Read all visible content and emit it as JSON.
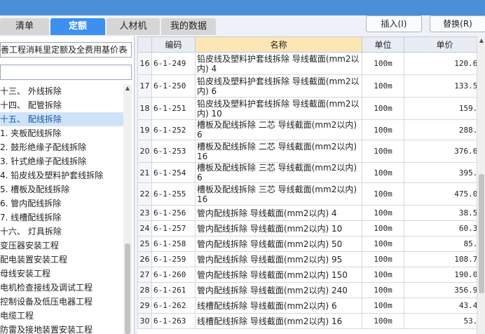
{
  "tabs": [
    {
      "label": "清单",
      "active": false
    },
    {
      "label": "定额",
      "active": true
    },
    {
      "label": "人材机",
      "active": false
    },
    {
      "label": "我的数据",
      "active": false
    }
  ],
  "toolbar": {
    "insert_label": "插入(I)",
    "replace_label": "替换(R)"
  },
  "left_panel": {
    "quota_library": "善工程消耗里定额及全费用基价表",
    "search_value": "",
    "tree_items": [
      {
        "label": "十三、 外线拆除",
        "selected": false
      },
      {
        "label": "十四、 配管拆除",
        "selected": false
      },
      {
        "label": "十五、 配线拆除",
        "selected": true
      },
      {
        "label": "1. 夹板配线拆除",
        "selected": false
      },
      {
        "label": "2. 鼓形绝缘子配线拆除",
        "selected": false
      },
      {
        "label": "3. 针式绝缘子配线拆除",
        "selected": false
      },
      {
        "label": "4. 铅皮线及塑料护套线拆除",
        "selected": false
      },
      {
        "label": "5. 槽板及配线拆除",
        "selected": false
      },
      {
        "label": "6. 管内配线拆除",
        "selected": false
      },
      {
        "label": "7. 线槽配线拆除",
        "selected": false
      },
      {
        "label": "十六、 灯具拆除",
        "selected": false
      },
      {
        "label": "变压器安装工程",
        "selected": false
      },
      {
        "label": "配电装置安装工程",
        "selected": false
      },
      {
        "label": "母线安装工程",
        "selected": false
      },
      {
        "label": "电机检查接线及调试工程",
        "selected": false
      },
      {
        "label": "控制设备及低压电器工程",
        "selected": false
      },
      {
        "label": "电缆工程",
        "selected": false
      },
      {
        "label": "防雷及接地装置安装工程",
        "selected": false
      }
    ]
  },
  "grid": {
    "headers": {
      "code": "编码",
      "name": "名称",
      "unit": "单位",
      "price": "单价"
    },
    "rows": [
      {
        "idx": "16",
        "code": "6-1-249",
        "name": "铅皮线及塑料护套线拆除 导线截面(mm2以内) 4",
        "unit": "100m",
        "price": "120.68"
      },
      {
        "idx": "17",
        "code": "6-1-250",
        "name": "铅皮线及塑料护套线拆除 导线截面(mm2以内) 6",
        "unit": "100m",
        "price": "133.52"
      },
      {
        "idx": "18",
        "code": "6-1-251",
        "name": "铅皮线及塑料护套线拆除 导线截面(mm2以内) 10",
        "unit": "100m",
        "price": "159.2"
      },
      {
        "idx": "19",
        "code": "6-1-252",
        "name": "槽板及配线拆除 二芯 导线截面(mm2以内) 6",
        "unit": "100m",
        "price": "288.9"
      },
      {
        "idx": "20",
        "code": "6-1-253",
        "name": "槽板及配线拆除 二芯 导线截面(mm2以内) 16",
        "unit": "100m",
        "price": "376.64"
      },
      {
        "idx": "21",
        "code": "6-1-254",
        "name": "槽板及配线拆除 三芯 导线截面(mm2以内) 6",
        "unit": "100m",
        "price": "395.9"
      },
      {
        "idx": "22",
        "code": "6-1-255",
        "name": "槽板及配线拆除 三芯 导线截面(mm2以内) 16",
        "unit": "100m",
        "price": "475.08"
      },
      {
        "idx": "23",
        "code": "6-1-256",
        "name": "管内配线拆除 导线截面(mm2以内) 4",
        "unit": "100m",
        "price": "38.52"
      },
      {
        "idx": "24",
        "code": "6-1-257",
        "name": "管内配线拆除 导线截面(mm2以内) 10",
        "unit": "100m",
        "price": "60.34"
      },
      {
        "idx": "25",
        "code": "6-1-258",
        "name": "管内配线拆除 导线截面(mm2以内) 50",
        "unit": "100m",
        "price": "85.6"
      },
      {
        "idx": "26",
        "code": "6-1-259",
        "name": "管内配线拆除 导线截面(mm2以内) 95",
        "unit": "100m",
        "price": "108.72"
      },
      {
        "idx": "27",
        "code": "6-1-260",
        "name": "管内配线拆除 导线截面(mm2以内) 150",
        "unit": "100m",
        "price": "190.04"
      },
      {
        "idx": "28",
        "code": "6-1-261",
        "name": "管内配线拆除 导线截面(mm2以内) 240",
        "unit": "100m",
        "price": "356.96"
      },
      {
        "idx": "29",
        "code": "6-1-262",
        "name": "线槽配线拆除 导线截面(mm2以内) 6",
        "unit": "100m",
        "price": "43.45"
      },
      {
        "idx": "30",
        "code": "6-1-263",
        "name": "线槽配线拆除 导线截面(mm2以内) 16",
        "unit": "100m",
        "price": "53.5"
      }
    ]
  },
  "colors": {
    "accent": "#3d8ff0",
    "selected_row": "#cfe3f8",
    "name_header": "#fde6b6"
  },
  "icons": {
    "combo_arrow": "chevron-down-icon",
    "scroll_up": "scroll-up-arrow-icon"
  }
}
